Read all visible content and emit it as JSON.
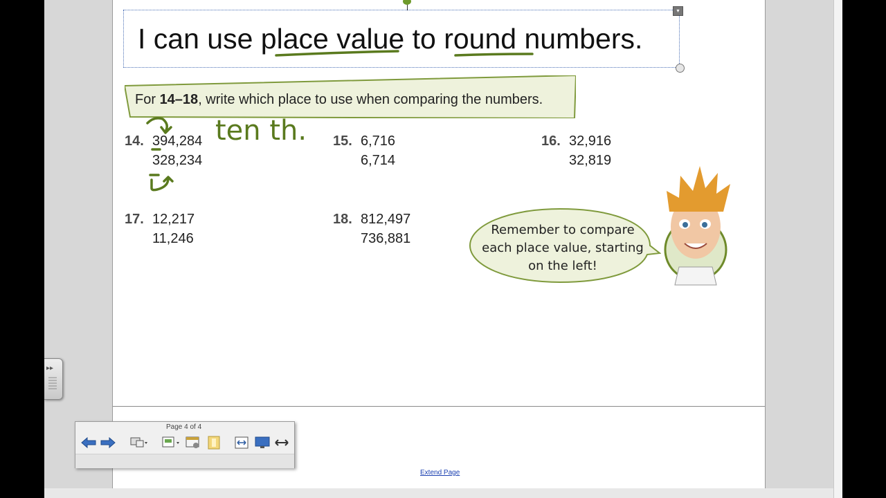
{
  "lesson": {
    "objective_prefix": "I can use ",
    "objective_term1": "place value",
    "objective_mid": " to ",
    "objective_term2": "round",
    "objective_suffix": " numbers."
  },
  "instructions": {
    "prefix": "For ",
    "range": "14–18",
    "suffix": ", write which place to use when comparing the numbers."
  },
  "problems": [
    {
      "number": "14.",
      "first": "394,284",
      "second": "328,234"
    },
    {
      "number": "15.",
      "first": "6,716",
      "second": "6,714"
    },
    {
      "number": "16.",
      "first": "32,916",
      "second": "32,819"
    },
    {
      "number": "17.",
      "first": "12,217",
      "second": "11,246"
    },
    {
      "number": "18.",
      "first": "812,497",
      "second": "736,881"
    }
  ],
  "handwriting": {
    "answer_14": "ten th."
  },
  "speech_bubble": {
    "text": "Remember to compare each place value, starting on the left!"
  },
  "toolbar": {
    "page_indicator": "Page 4 of 4"
  },
  "footer": {
    "extend_page": "Extend Page"
  },
  "colors": {
    "ink_green": "#5a7a1e",
    "banner_fill": "#eef2dc",
    "banner_border": "#7f9a3c",
    "bubble_fill": "#eef2dc"
  }
}
